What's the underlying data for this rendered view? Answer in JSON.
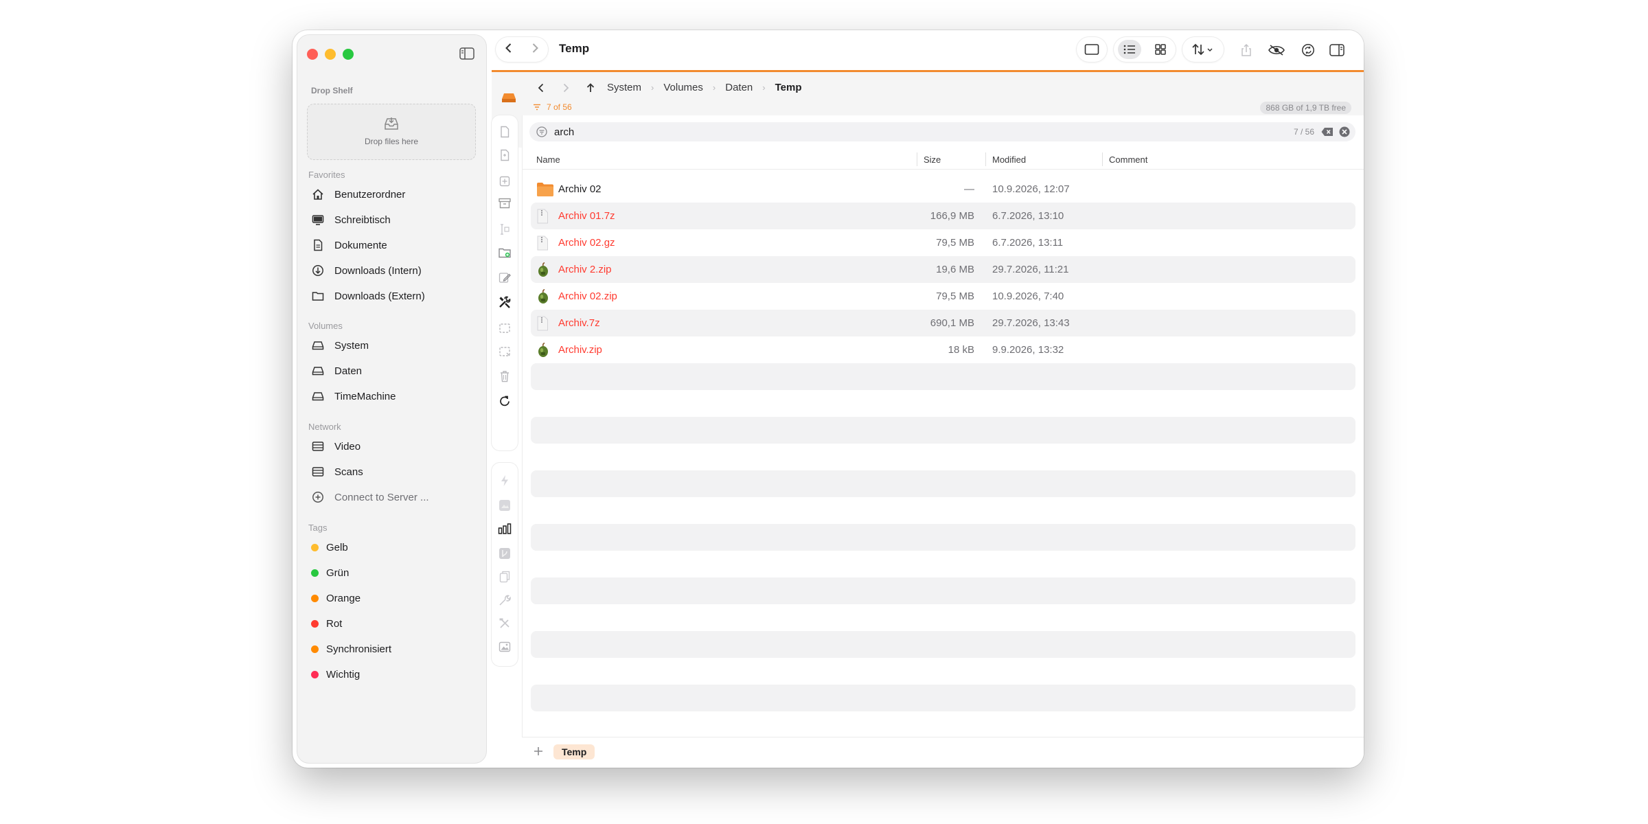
{
  "window": {
    "title": "Temp"
  },
  "sidebar": {
    "drop_shelf": {
      "title": "Drop Shelf",
      "hint": "Drop files here"
    },
    "favorites": {
      "title": "Favorites",
      "items": [
        {
          "label": "Benutzerordner",
          "icon": "home-icon"
        },
        {
          "label": "Schreibtisch",
          "icon": "desktop-icon"
        },
        {
          "label": "Dokumente",
          "icon": "document-icon"
        },
        {
          "label": "Downloads (Intern)",
          "icon": "download-icon"
        },
        {
          "label": "Downloads (Extern)",
          "icon": "folder-icon"
        }
      ]
    },
    "volumes": {
      "title": "Volumes",
      "items": [
        {
          "label": "System",
          "icon": "drive-icon"
        },
        {
          "label": "Daten",
          "icon": "drive-icon"
        },
        {
          "label": "TimeMachine",
          "icon": "drive-icon"
        }
      ]
    },
    "network": {
      "title": "Network",
      "items": [
        {
          "label": "Video",
          "icon": "server-icon"
        },
        {
          "label": "Scans",
          "icon": "server-icon"
        },
        {
          "label": "Connect to Server ...",
          "icon": "plus-circle-icon"
        }
      ]
    },
    "tags": {
      "title": "Tags",
      "items": [
        {
          "label": "Gelb",
          "color": "#febc2e"
        },
        {
          "label": "Grün",
          "color": "#28c840"
        },
        {
          "label": "Orange",
          "color": "#ff8a00"
        },
        {
          "label": "Rot",
          "color": "#ff3b30"
        },
        {
          "label": "Synchronisiert",
          "color": "#ff8a00"
        },
        {
          "label": "Wichtig",
          "color": "#ff2d55"
        }
      ]
    }
  },
  "pathbar": {
    "crumbs": [
      "System",
      "Volumes",
      "Daten",
      "Temp"
    ],
    "count": "7 of 56",
    "free_space": "868 GB of 1,9 TB free"
  },
  "search": {
    "value": "arch",
    "count": "7 / 56"
  },
  "columns": {
    "name": "Name",
    "size": "Size",
    "modified": "Modified",
    "comment": "Comment"
  },
  "files": [
    {
      "name": "Archiv 02",
      "size": "—",
      "modified": "10.9.2026, 12:07",
      "kind": "folder",
      "red": false
    },
    {
      "name": "Archiv 01.7z",
      "size": "166,9 MB",
      "modified": "6.7.2026, 13:10",
      "kind": "archive",
      "red": true
    },
    {
      "name": "Archiv 02.gz",
      "size": "79,5 MB",
      "modified": "6.7.2026, 13:11",
      "kind": "archive",
      "red": true
    },
    {
      "name": "Archiv 2.zip",
      "size": "19,6 MB",
      "modified": "29.7.2026, 11:21",
      "kind": "zip",
      "red": true
    },
    {
      "name": "Archiv 02.zip",
      "size": "79,5 MB",
      "modified": "10.9.2026, 7:40",
      "kind": "zip",
      "red": true
    },
    {
      "name": "Archiv.7z",
      "size": "690,1 MB",
      "modified": "29.7.2026, 13:43",
      "kind": "archive",
      "red": true
    },
    {
      "name": "Archiv.zip",
      "size": "18 kB",
      "modified": "9.9.2026, 13:32",
      "kind": "zip",
      "red": true
    }
  ],
  "tabs": [
    {
      "label": "Temp"
    }
  ],
  "colors": {
    "accent": "#f28b2f",
    "error_red": "#ff3b30"
  }
}
